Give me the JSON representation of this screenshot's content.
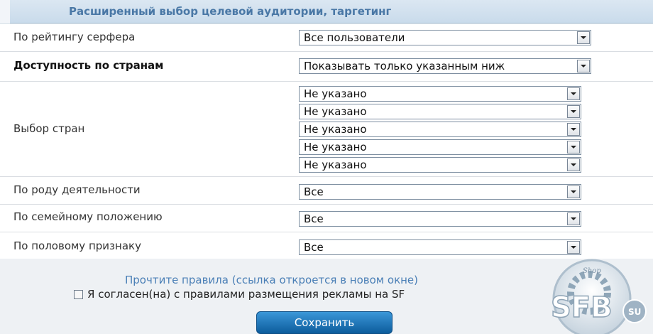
{
  "header": {
    "title": "Расширенный выбор целевой аудитории, таргетинг"
  },
  "rows": {
    "rating": {
      "label": "По рейтингу серфера",
      "value": "Все пользователи"
    },
    "countries_access": {
      "label": "Доступность по странам",
      "value": "Показывать только указанным ниж"
    },
    "countries": {
      "label": "Выбор стран",
      "values": [
        "Не указано",
        "Не указано",
        "Не указано",
        "Не указано",
        "Не указано"
      ]
    },
    "occupation": {
      "label": "По роду деятельности",
      "value": "Все"
    },
    "marital": {
      "label": "По семейному положению",
      "value": "Все"
    },
    "gender": {
      "label": "По половому признаку",
      "value": "Все"
    }
  },
  "footer": {
    "rules_link": "Прочтите правила (ссылка откроется в новом окне)",
    "agree_text": "Я согласен(на) с правилами размещения рекламы на SF",
    "save_button": "Сохранить"
  },
  "logo": {
    "text": "SFB",
    "suffix": "SU",
    "shop": "Shop"
  }
}
